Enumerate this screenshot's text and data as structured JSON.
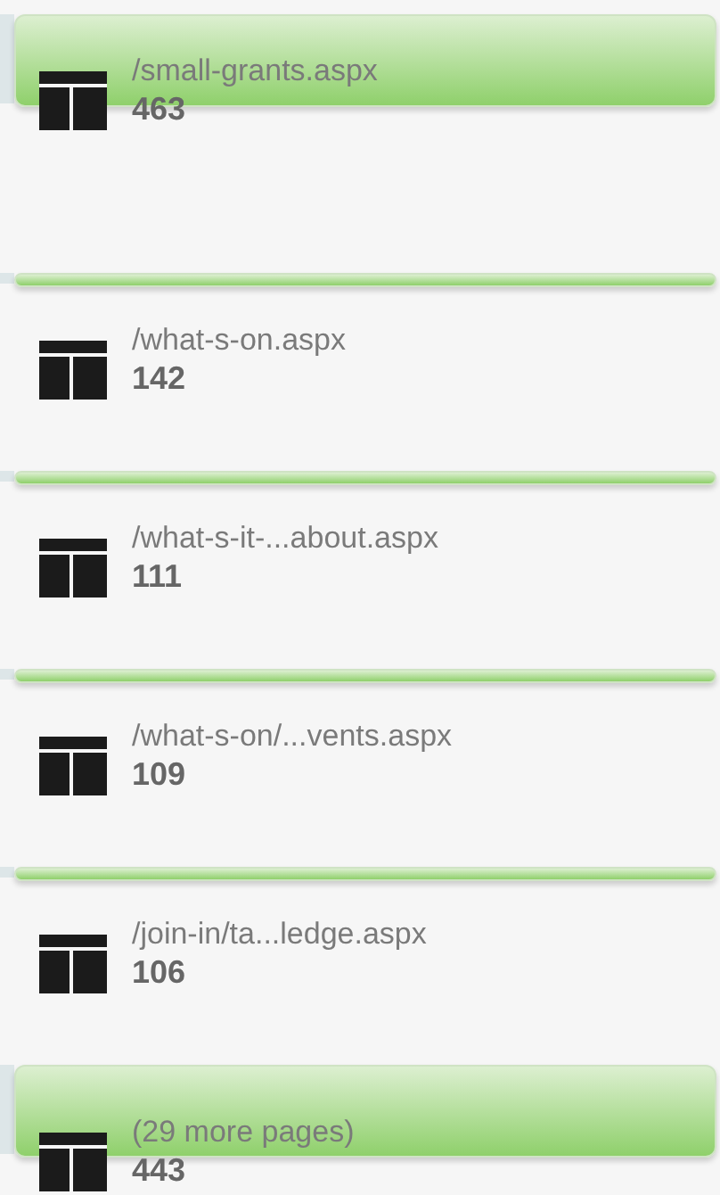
{
  "nodes": [
    {
      "kind": "tall",
      "path": "/small-grants.aspx",
      "count": "463"
    },
    {
      "kind": "thin",
      "path": "/what-s-on.aspx",
      "count": "142"
    },
    {
      "kind": "thin",
      "path": "/what-s-it-...about.aspx",
      "count": "111"
    },
    {
      "kind": "thin",
      "path": "/what-s-on/...vents.aspx",
      "count": "109"
    },
    {
      "kind": "thin",
      "path": "/join-in/ta...ledge.aspx",
      "count": "106"
    },
    {
      "kind": "tall",
      "path": "(29 more pages)",
      "count": "443"
    }
  ]
}
